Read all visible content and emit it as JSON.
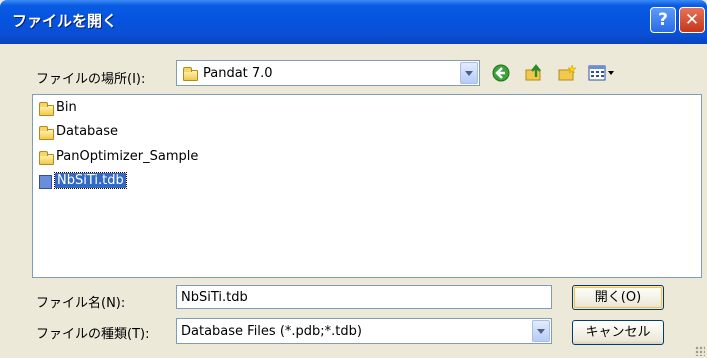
{
  "window": {
    "title": "ファイルを開く",
    "help_label": "?",
    "close_label": "✕"
  },
  "location": {
    "label": "ファイルの場所(I):",
    "value": "Pandat 7.0"
  },
  "toolbar": {
    "icons": [
      "back-icon",
      "up-folder-icon",
      "new-folder-icon",
      "view-menu-icon"
    ]
  },
  "files": [
    {
      "name": "Bin",
      "type": "folder",
      "selected": false
    },
    {
      "name": "Database",
      "type": "folder",
      "selected": false
    },
    {
      "name": "PanOptimizer_Sample",
      "type": "folder",
      "selected": false
    },
    {
      "name": "NbSiTi.tdb",
      "type": "file",
      "selected": true
    }
  ],
  "filename": {
    "label": "ファイル名(N):",
    "value": "NbSiTi.tdb"
  },
  "filetype": {
    "label": "ファイルの種類(T):",
    "value": "Database Files (*.pdb;*.tdb)"
  },
  "buttons": {
    "open_label": "開く(O)",
    "cancel_label": "キャンセル"
  },
  "colors": {
    "titlebar": "#0554e0",
    "selection": "#316ac5",
    "dialog": "#ece9d8"
  }
}
